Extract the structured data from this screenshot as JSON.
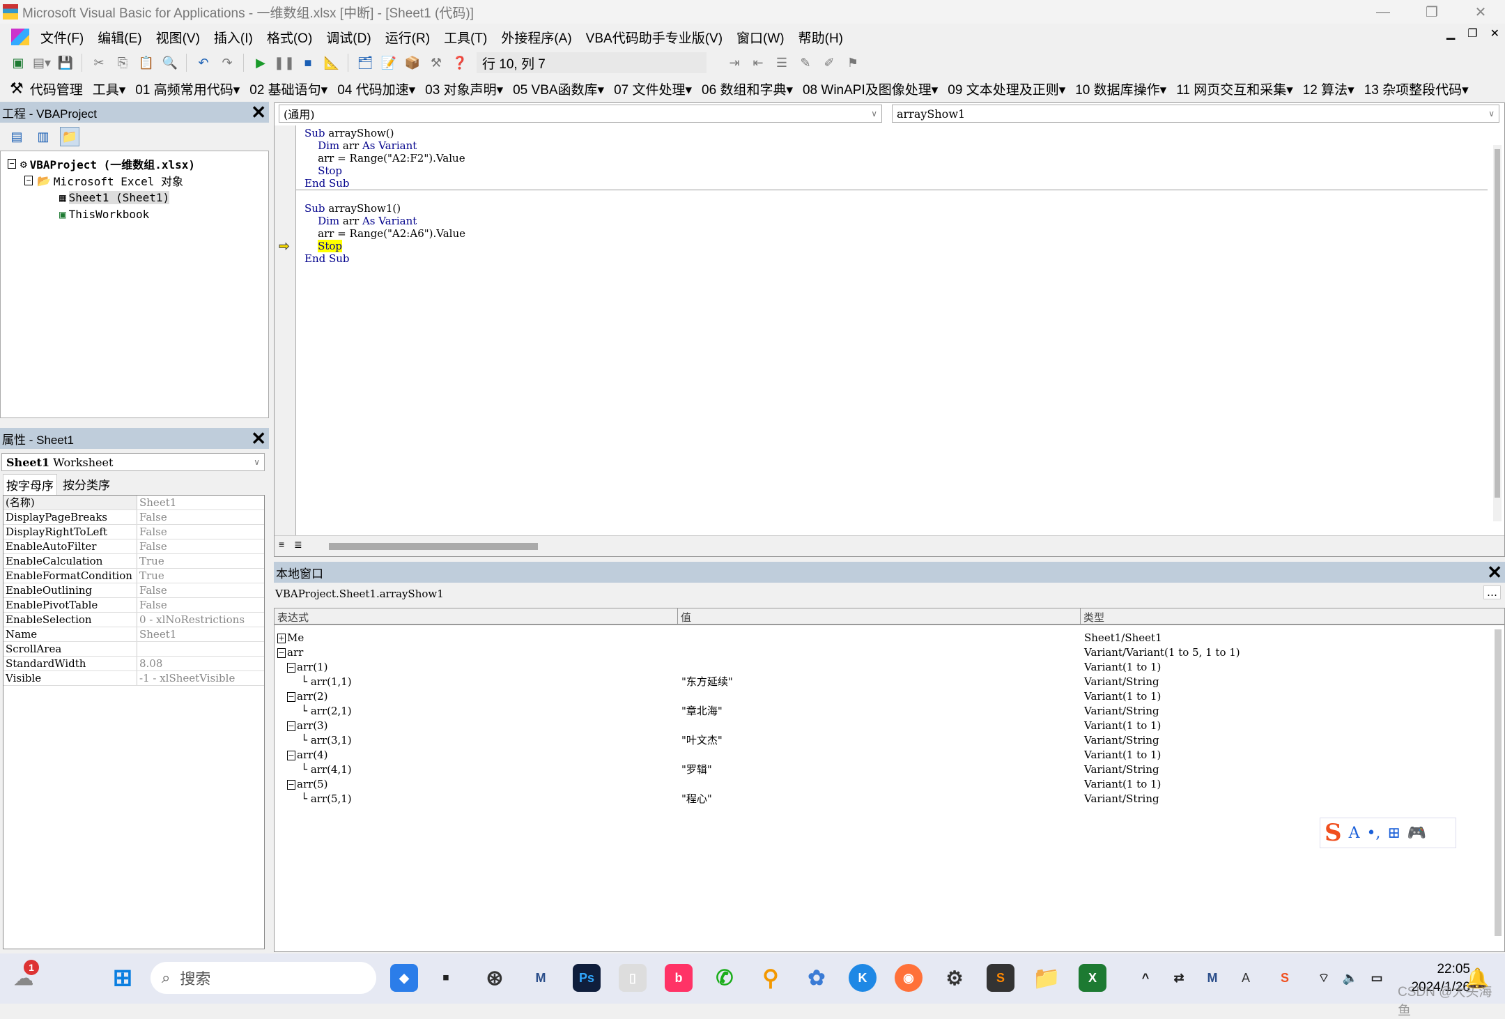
{
  "window": {
    "title": "Microsoft Visual Basic for Applications - 一维数组.xlsx [中断] - [Sheet1 (代码)]",
    "minimize": "—",
    "restore": "❐",
    "close": "✕"
  },
  "menu": [
    "文件(F)",
    "编辑(E)",
    "视图(V)",
    "插入(I)",
    "格式(O)",
    "调试(D)",
    "运行(R)",
    "工具(T)",
    "外接程序(A)",
    "VBA代码助手专业版(V)",
    "窗口(W)",
    "帮助(H)"
  ],
  "toolbar": {
    "position": "行 10, 列 7"
  },
  "addin_toolbar": [
    "代码管理",
    "工具▾",
    "01 高频常用代码▾",
    "02 基础语句▾",
    "04 代码加速▾",
    "03 对象声明▾",
    "05 VBA函数库▾",
    "07 文件处理▾",
    "06 数组和字典▾",
    "08 WinAPI及图像处理▾",
    "09 文本处理及正则▾",
    "10 数据库操作▾",
    "11 网页交互和采集▾",
    "12 算法▾",
    "13 杂项整段代码▾"
  ],
  "project": {
    "title": "工程 - VBAProject",
    "root": "VBAProject (一维数组.xlsx)",
    "folder": "Microsoft Excel 对象",
    "items": [
      "Sheet1 (Sheet1)",
      "ThisWorkbook"
    ]
  },
  "properties": {
    "title": "属性 - Sheet1",
    "object_bold": "Sheet1",
    "object_type": "Worksheet",
    "tabs": [
      "按字母序",
      "按分类序"
    ],
    "rows": [
      [
        "(名称)",
        "Sheet1"
      ],
      [
        "DisplayPageBreaks",
        "False"
      ],
      [
        "DisplayRightToLeft",
        "False"
      ],
      [
        "EnableAutoFilter",
        "False"
      ],
      [
        "EnableCalculation",
        "True"
      ],
      [
        "EnableFormatCondition",
        "True"
      ],
      [
        "EnableOutlining",
        "False"
      ],
      [
        "EnablePivotTable",
        "False"
      ],
      [
        "EnableSelection",
        "0 - xlNoRestrictions"
      ],
      [
        "Name",
        "Sheet1"
      ],
      [
        "ScrollArea",
        ""
      ],
      [
        "StandardWidth",
        "8.08"
      ],
      [
        "Visible",
        "-1 - xlSheetVisible"
      ]
    ]
  },
  "code": {
    "object_combo": "(通用)",
    "proc_combo": "arrayShow1",
    "lines": [
      [
        [
          "kw",
          "Sub"
        ],
        [
          "p",
          " arrayShow()"
        ]
      ],
      [
        [
          "p",
          "    "
        ],
        [
          "kw",
          "Dim"
        ],
        [
          "p",
          " arr "
        ],
        [
          "kw",
          "As"
        ],
        [
          "p",
          " "
        ],
        [
          "kw",
          "Variant"
        ]
      ],
      [
        [
          "p",
          "    arr = Range(\"A2:F2\").Value"
        ]
      ],
      [
        [
          "p",
          "    "
        ],
        [
          "kw",
          "Stop"
        ]
      ],
      [
        [
          "kw",
          "End Sub"
        ]
      ],
      [
        [
          "p",
          ""
        ]
      ],
      [
        [
          "kw",
          "Sub"
        ],
        [
          "p",
          " arrayShow1()"
        ]
      ],
      [
        [
          "p",
          "    "
        ],
        [
          "kw",
          "Dim"
        ],
        [
          "p",
          " arr "
        ],
        [
          "kw",
          "As"
        ],
        [
          "p",
          " "
        ],
        [
          "kw",
          "Variant"
        ]
      ],
      [
        [
          "p",
          "    arr = Range(\"A2:A6\").Value"
        ]
      ],
      [
        [
          "p",
          "    "
        ],
        [
          "hl",
          "Stop"
        ]
      ],
      [
        [
          "kw",
          "End Sub"
        ]
      ]
    ]
  },
  "locals": {
    "title": "本地窗口",
    "context": "VBAProject.Sheet1.arrayShow1",
    "columns": [
      "表达式",
      "值",
      "类型"
    ],
    "rows": [
      {
        "lvl": 0,
        "box": "+",
        "expr": "Me",
        "value": "",
        "type": "Sheet1/Sheet1"
      },
      {
        "lvl": 0,
        "box": "−",
        "expr": "arr",
        "value": "",
        "type": "Variant/Variant(1 to 5, 1 to 1)"
      },
      {
        "lvl": 1,
        "box": "−",
        "expr": "arr(1)",
        "value": "",
        "type": "Variant(1 to 1)"
      },
      {
        "lvl": 2,
        "box": "",
        "expr": "arr(1,1)",
        "value": "\"东方延续\"",
        "type": "Variant/String"
      },
      {
        "lvl": 1,
        "box": "−",
        "expr": "arr(2)",
        "value": "",
        "type": "Variant(1 to 1)"
      },
      {
        "lvl": 2,
        "box": "",
        "expr": "arr(2,1)",
        "value": "\"章北海\"",
        "type": "Variant/String"
      },
      {
        "lvl": 1,
        "box": "−",
        "expr": "arr(3)",
        "value": "",
        "type": "Variant(1 to 1)"
      },
      {
        "lvl": 2,
        "box": "",
        "expr": "arr(3,1)",
        "value": "\"叶文杰\"",
        "type": "Variant/String"
      },
      {
        "lvl": 1,
        "box": "−",
        "expr": "arr(4)",
        "value": "",
        "type": "Variant(1 to 1)"
      },
      {
        "lvl": 2,
        "box": "",
        "expr": "arr(4,1)",
        "value": "\"罗辑\"",
        "type": "Variant/String"
      },
      {
        "lvl": 1,
        "box": "−",
        "expr": "arr(5)",
        "value": "",
        "type": "Variant(1 to 1)"
      },
      {
        "lvl": 2,
        "box": "",
        "expr": "arr(5,1)",
        "value": "\"程心\"",
        "type": "Variant/String"
      }
    ]
  },
  "ime": {
    "logo": "S",
    "items": [
      "A",
      "•,",
      "⊞",
      "🎮"
    ]
  },
  "taskbar": {
    "search": "搜索",
    "badge": "1",
    "time": "22:05",
    "date": "2024/1/26",
    "watermark": "CSDN @大头海鱼"
  },
  "colors": {
    "pane_header": "#bfcddb",
    "keyword": "#00008b",
    "highlight": "#ffff00",
    "arrow": "#f5d800"
  }
}
